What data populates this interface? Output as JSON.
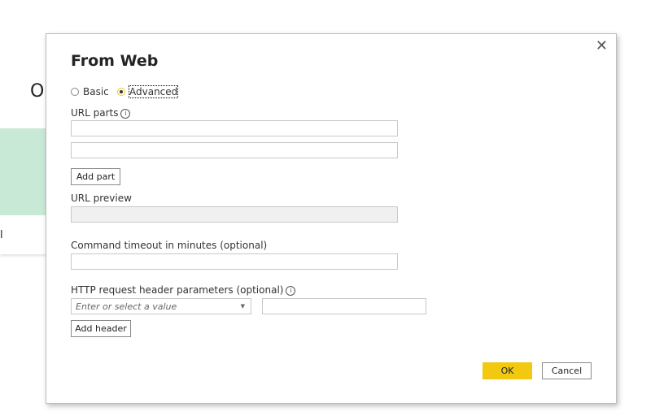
{
  "background": {
    "title_fragment": "O",
    "card_fragment": "l"
  },
  "dialog": {
    "title": "From Web",
    "close_icon": "close-icon",
    "mode": {
      "options": [
        "Basic",
        "Advanced"
      ],
      "selected": "Advanced"
    },
    "url_parts_label": "URL parts",
    "url_parts": [
      "",
      ""
    ],
    "add_part_label": "Add part",
    "url_preview_label": "URL preview",
    "url_preview_value": "",
    "timeout_label": "Command timeout in minutes (optional)",
    "timeout_value": "",
    "headers_label": "HTTP request header parameters (optional)",
    "header_name_placeholder": "Enter or select a value",
    "header_value": "",
    "add_header_label": "Add header",
    "ok_label": "OK",
    "cancel_label": "Cancel",
    "accent_color": "#f2c811"
  }
}
